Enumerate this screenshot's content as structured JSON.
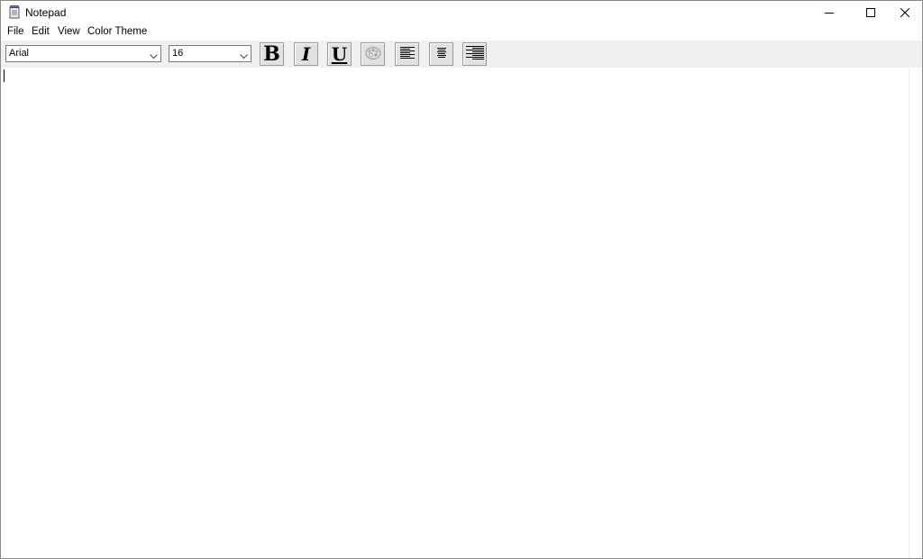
{
  "window": {
    "title": "Notepad"
  },
  "menu": {
    "items": [
      "File",
      "Edit",
      "View",
      "Color Theme"
    ]
  },
  "toolbar": {
    "font_value": "Arial",
    "size_value": "16"
  },
  "editor": {
    "content": ""
  },
  "icons": {
    "app": "notepad-icon",
    "minimize": "minimize-icon",
    "maximize": "maximize-icon",
    "close": "close-icon",
    "bold": "bold-icon",
    "italic": "italic-icon",
    "underline": "underline-icon",
    "color": "color-palette-icon",
    "align_left": "align-left-icon",
    "align_center": "align-center-icon",
    "align_right": "align-right-icon"
  }
}
